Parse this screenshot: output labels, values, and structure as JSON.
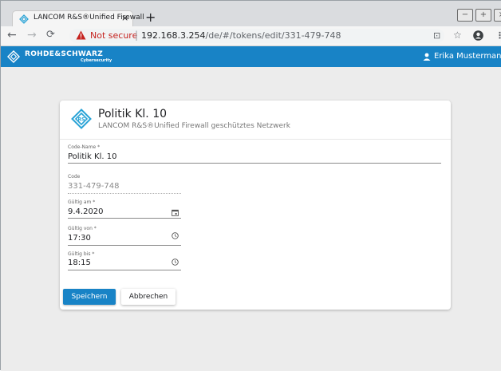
{
  "browser": {
    "tab_title": "LANCOM R&S®Unified Firewall",
    "tab_close": "×",
    "new_tab": "+",
    "not_secure": "Not secure",
    "separator": "|",
    "url_host": "192.168.3.254",
    "url_path": "/de/#/tokens/edit/331-479-748",
    "win_minimize": "−",
    "win_maximize": "+",
    "win_close": "×"
  },
  "appbar": {
    "brand": "ROHDE&SCHWARZ",
    "brand_sub": "Cybersecurity",
    "user_name": "Erika Mustermann",
    "color": "#1883c6"
  },
  "card": {
    "title": "Politik Kl. 10",
    "subtitle": "LANCOM R&S®Unified Firewall geschütztes Netzwerk"
  },
  "form": {
    "code_name_label": "Code-Name *",
    "code_name_value": "Politik Kl. 10",
    "code_label": "Code",
    "code_value": "331-479-748",
    "date_label": "Gültig am *",
    "date_value": "9.4.2020",
    "from_label": "Gültig von *",
    "from_value": "17:30",
    "to_label": "Gültig bis *",
    "to_value": "18:15"
  },
  "buttons": {
    "save": "Speichern",
    "cancel": "Abbrechen"
  }
}
